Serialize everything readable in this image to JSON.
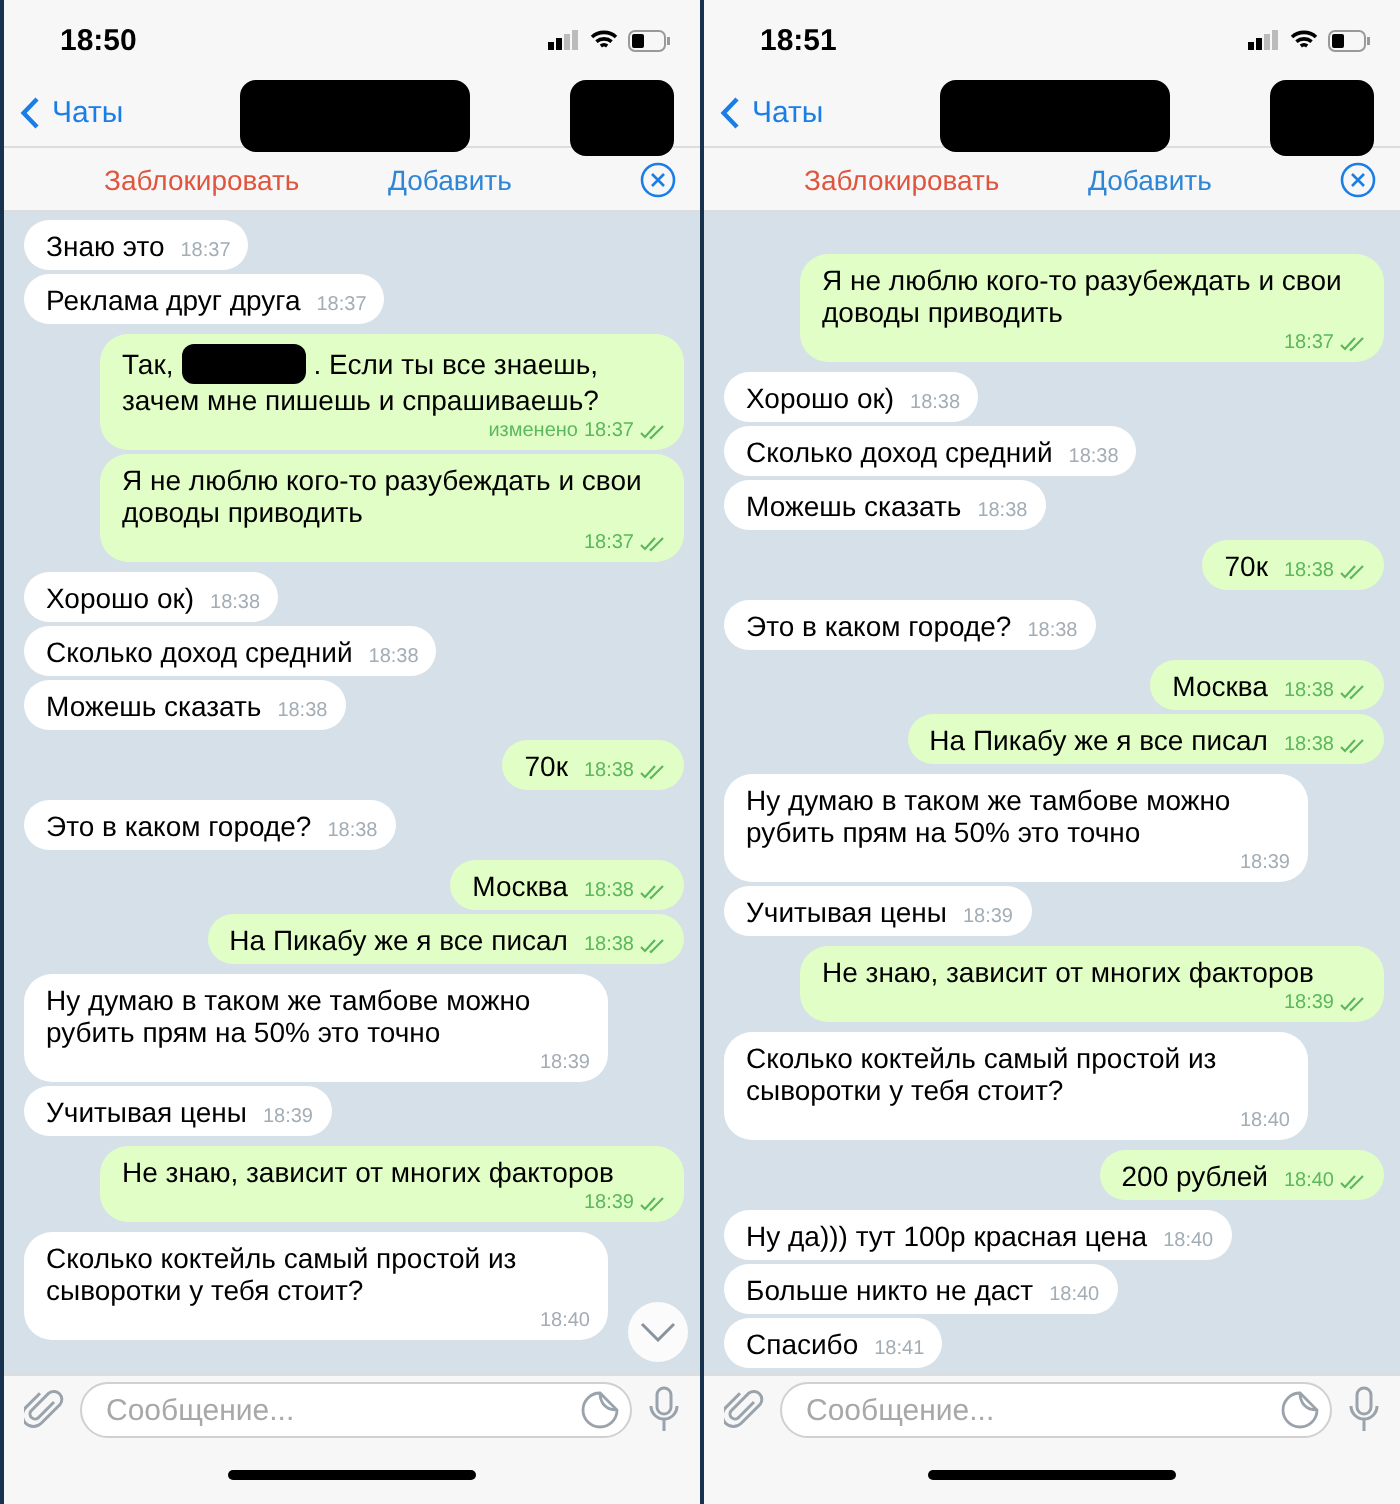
{
  "panels": [
    {
      "status_time": "18:50",
      "back": "Чаты",
      "block": "Заблокировать",
      "add": "Добавить",
      "placeholder": "Сообщение...",
      "scroll_down_button": true,
      "messages": [
        {
          "kind": "in",
          "text": "Знаю это",
          "time": "18:37"
        },
        {
          "kind": "in",
          "text": "Реклама друг друга",
          "time": "18:37"
        },
        {
          "kind": "out",
          "lead": "Так,",
          "redacted": true,
          "text": ". Если ты все знаешь,",
          "continuation": "зачем мне пишешь и спрашиваешь?",
          "edited": "изменено",
          "time": "18:37",
          "read": true
        },
        {
          "kind": "out",
          "text": "Я не люблю кого-то разубеждать и свои доводы приводить",
          "time": "18:37",
          "read": true
        },
        {
          "kind": "in",
          "text": "Хорошо ок)",
          "time": "18:38"
        },
        {
          "kind": "in",
          "text": "Сколько доход средний",
          "time": "18:38"
        },
        {
          "kind": "in",
          "text": "Можешь сказать",
          "time": "18:38"
        },
        {
          "kind": "out",
          "text": "70к",
          "time": "18:38",
          "read": true
        },
        {
          "kind": "in",
          "text": "Это в каком городе?",
          "time": "18:38"
        },
        {
          "kind": "out",
          "text": "Москва",
          "time": "18:38",
          "read": true
        },
        {
          "kind": "out",
          "text": "На Пикабу же я все писал",
          "time": "18:38",
          "read": true
        },
        {
          "kind": "in",
          "text": "Ну думаю в таком же тамбове можно рубить прям на 50% это точно",
          "time": "18:39"
        },
        {
          "kind": "in",
          "text": "Учитывая цены",
          "time": "18:39"
        },
        {
          "kind": "out",
          "text": "Не знаю, зависит от многих факторов",
          "time": "18:39",
          "read": true
        },
        {
          "kind": "in",
          "text": "Сколько коктейль самый простой из сыворотки у тебя стоит?",
          "time": "18:40"
        }
      ]
    },
    {
      "status_time": "18:51",
      "back": "Чаты",
      "block": "Заблокировать",
      "add": "Добавить",
      "placeholder": "Сообщение...",
      "scroll_down_button": false,
      "messages": [
        {
          "kind": "out",
          "text": "Я не люблю кого-то разубеждать и свои доводы приводить",
          "time": "18:37",
          "read": true
        },
        {
          "kind": "in",
          "text": "Хорошо ок)",
          "time": "18:38"
        },
        {
          "kind": "in",
          "text": "Сколько доход средний",
          "time": "18:38"
        },
        {
          "kind": "in",
          "text": "Можешь сказать",
          "time": "18:38"
        },
        {
          "kind": "out",
          "text": "70к",
          "time": "18:38",
          "read": true
        },
        {
          "kind": "in",
          "text": "Это в каком городе?",
          "time": "18:38"
        },
        {
          "kind": "out",
          "text": "Москва",
          "time": "18:38",
          "read": true
        },
        {
          "kind": "out",
          "text": "На Пикабу же я все писал",
          "time": "18:38",
          "read": true
        },
        {
          "kind": "in",
          "text": "Ну думаю в таком же тамбове можно рубить прям на 50% это точно",
          "time": "18:39"
        },
        {
          "kind": "in",
          "text": "Учитывая цены",
          "time": "18:39"
        },
        {
          "kind": "out",
          "text": "Не знаю, зависит от многих факторов",
          "time": "18:39",
          "read": true
        },
        {
          "kind": "in",
          "text": "Сколько коктейль самый простой из сыворотки у тебя стоит?",
          "time": "18:40"
        },
        {
          "kind": "out",
          "text": "200 рублей",
          "time": "18:40",
          "read": true
        },
        {
          "kind": "in",
          "text": "Ну да))) тут 100р красная цена",
          "time": "18:40"
        },
        {
          "kind": "in",
          "text": "Больше никто не даст",
          "time": "18:40"
        },
        {
          "kind": "in",
          "text": "Спасибо",
          "time": "18:41"
        }
      ]
    }
  ]
}
